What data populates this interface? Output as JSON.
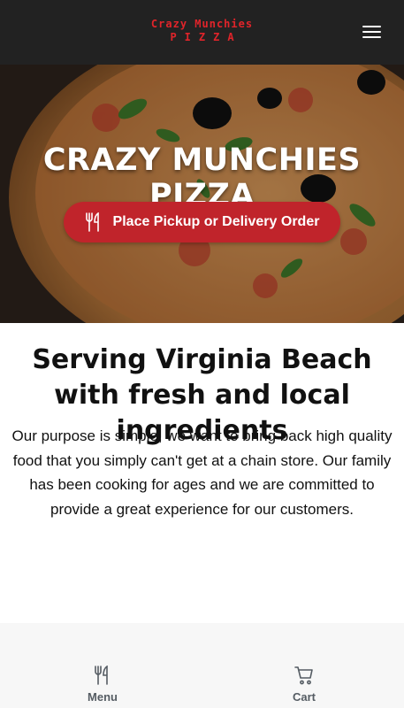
{
  "header": {
    "logo_line1": "Crazy Munchies",
    "logo_line2": "PIZZA",
    "menu_icon": "hamburger-icon"
  },
  "hero": {
    "title": "CRAZY MUNCHIES PIZZA",
    "order_button_label": "Place Pickup or Delivery Order",
    "order_button_icon": "fork-knife-icon"
  },
  "about": {
    "heading": "Serving Virginia Beach with fresh and local ingredients",
    "body": "Our purpose is simple, we want to bring back high quality food that you simply can't get at a chain store. Our family has been cooking for ages and we are committed to provide a great experience for our customers."
  },
  "bottom_nav": {
    "menu_label": "Menu",
    "menu_icon": "fork-knife-icon",
    "cart_label": "Cart",
    "cart_icon": "cart-icon"
  },
  "colors": {
    "header_bg": "#222222",
    "logo_red": "#e0242a",
    "button_red": "#c0242b",
    "nav_gray": "#555c63"
  }
}
